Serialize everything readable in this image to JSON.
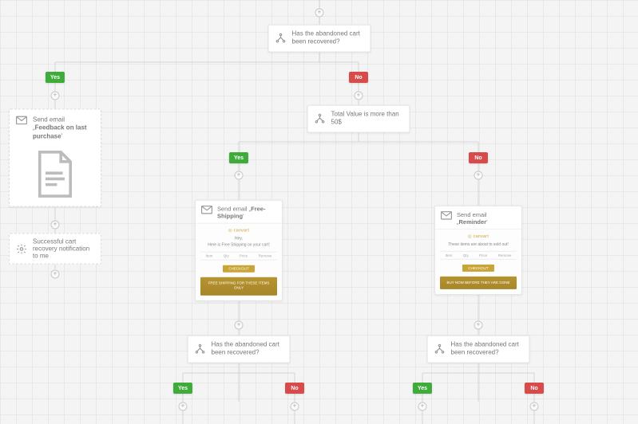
{
  "labels": {
    "yes": "Yes",
    "no": "No"
  },
  "nodes": {
    "top_decision": {
      "text": "Has the abandoned cart been recovered?"
    },
    "feedback_card": {
      "title_prefix": "Send email „",
      "title_bold": "Feedback on last purchase",
      "title_suffix": "'"
    },
    "gear_notify": {
      "text": "Successful cart recovery notification to me"
    },
    "value_decision": {
      "text": "Total Value is more than 50$"
    },
    "email_free_shipping": {
      "title_prefix": "Send email „",
      "title_bold": "Free-Shipping",
      "title_suffix": "'",
      "preview": {
        "brand": "◎ canvart",
        "line1": "Hey,",
        "line2": "Here is Free Shipping on your cart!",
        "row": [
          "Item",
          "Qty",
          "Price",
          "Remove"
        ],
        "cta": "CHECKOUT",
        "banner": "FREE SHIPPING FOR THESE ITEMS ONLY"
      }
    },
    "email_reminder": {
      "title_prefix": "Send email „",
      "title_bold": "Reminder",
      "title_suffix": "'",
      "preview": {
        "brand": "◎ canvart",
        "line1": "These items are about to sold out!",
        "line2": "",
        "row": [
          "Item",
          "Qty",
          "Price",
          "Remove"
        ],
        "cta": "CHECKOUT",
        "banner": "BUY NOW BEFORE THEY ARE GONE"
      }
    },
    "bottom_decision": {
      "text": "Has the abandoned cart been recovered?"
    }
  }
}
